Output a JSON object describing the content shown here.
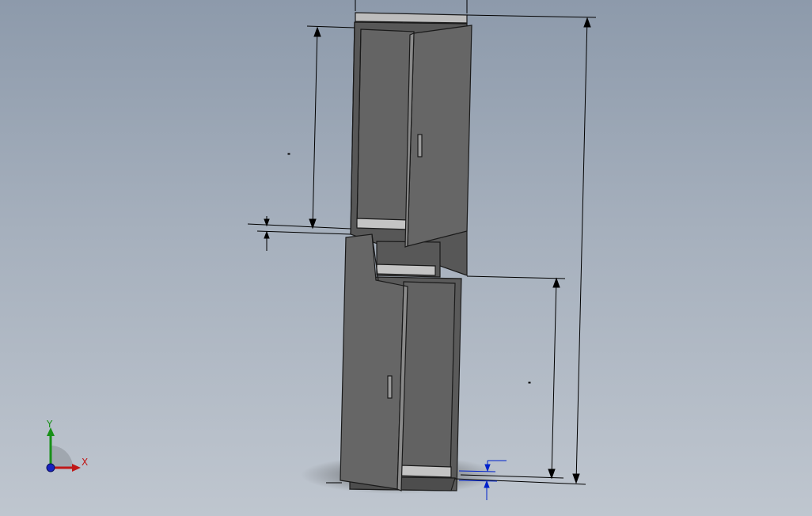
{
  "viewport": {
    "background_top": "#8d9aab",
    "background_bottom": "#bfc6cf"
  },
  "model": {
    "body_color": "#626262",
    "edge_color": "#1a1a1a",
    "shelf_color": "#c4c4c4",
    "dimension_color": "#000000",
    "foot_dimension_color": "#0022cc"
  },
  "triad": {
    "x_label": "X",
    "y_label": "Y",
    "x_color": "#c01818",
    "y_color": "#189018",
    "z_color": "#1822c0"
  }
}
